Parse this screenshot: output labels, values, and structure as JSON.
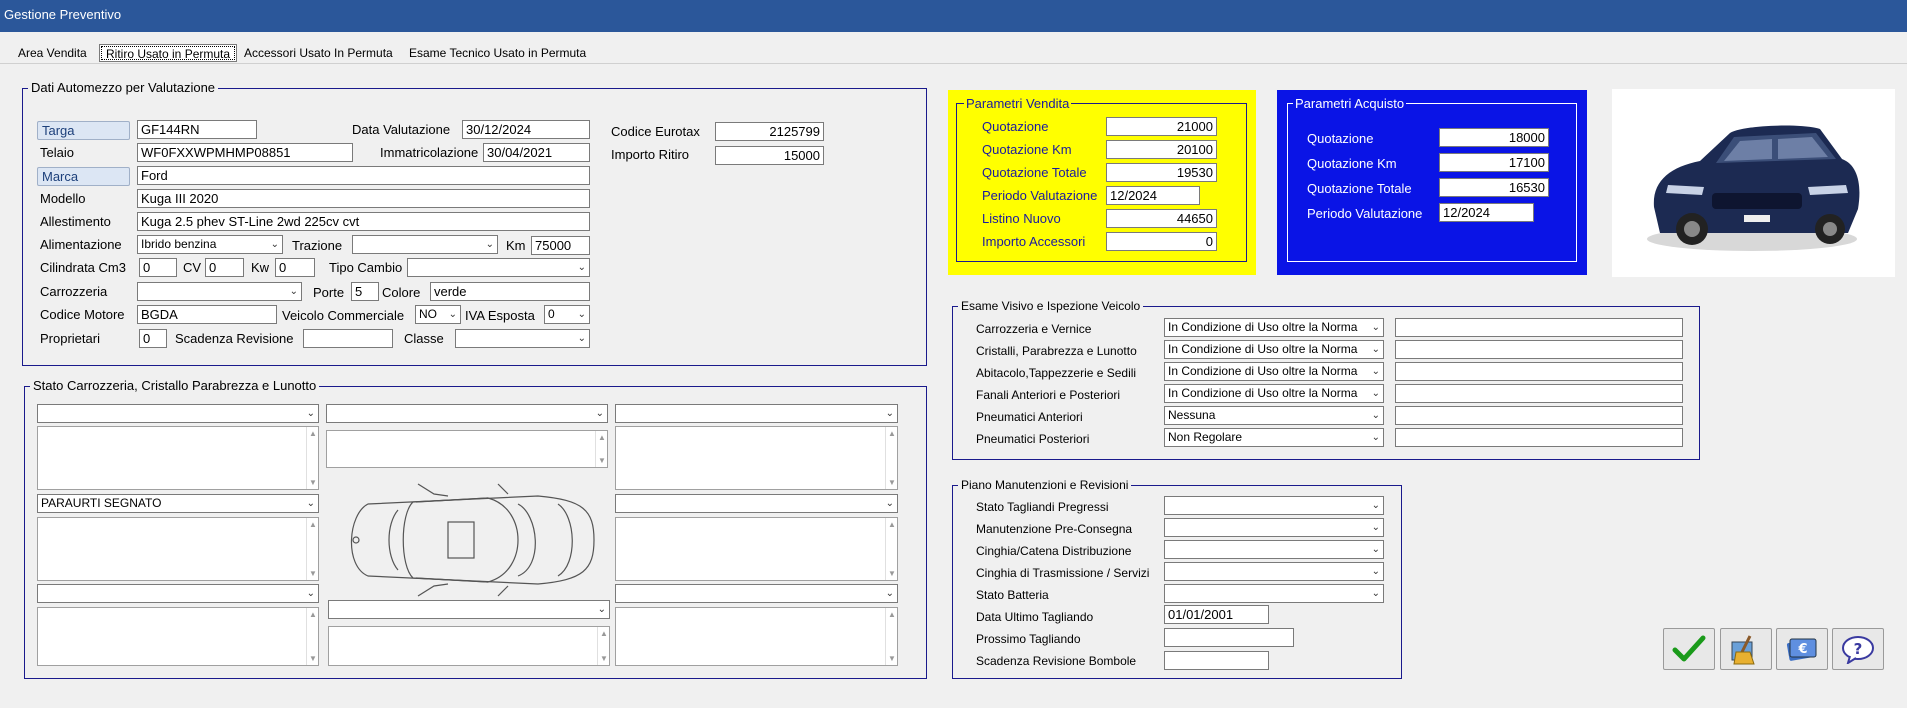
{
  "window": {
    "title": "Gestione Preventivo"
  },
  "tabs": [
    {
      "label": "Area Vendita"
    },
    {
      "label": "Ritiro Usato in Permuta"
    },
    {
      "label": "Accessori Usato In  Permuta"
    },
    {
      "label": "Esame Tecnico Usato in Permuta"
    }
  ],
  "vehicle": {
    "legend": "Dati Automezzo per Valutazione",
    "targa_label": "Targa",
    "targa": "GF144RN",
    "data_valutazione_label": "Data Valutazione",
    "data_valutazione": "30/12/2024",
    "codice_eurotax_label": "Codice Eurotax",
    "codice_eurotax": "2125799",
    "telaio_label": "Telaio",
    "telaio": "WF0FXXWPMHMP08851",
    "immatricolazione_label": "Immatricolazione",
    "immatricolazione": "30/04/2021",
    "importo_ritiro_label": "Importo Ritiro",
    "importo_ritiro": "15000",
    "marca_label": "Marca",
    "marca": "Ford",
    "modello_label": "Modello",
    "modello": "Kuga III 2020",
    "allestimento_label": "Allestimento",
    "allestimento": "Kuga 2.5 phev ST-Line 2wd 225cv cvt",
    "alimentazione_label": "Alimentazione",
    "alimentazione": "Ibrido benzina",
    "trazione_label": "Trazione",
    "trazione": "",
    "km_label": "Km",
    "km": "75000",
    "cilindrata_label": "Cilindrata Cm3",
    "cilindrata": "0",
    "cv_label": "CV",
    "cv": "0",
    "kw_label": "Kw",
    "kw": "0",
    "tipo_cambio_label": "Tipo Cambio",
    "tipo_cambio": "",
    "carrozzeria_label": "Carrozzeria",
    "carrozzeria": "",
    "porte_label": "Porte",
    "porte": "5",
    "colore_label": "Colore",
    "colore": "verde",
    "codice_motore_label": "Codice Motore",
    "codice_motore": "BGDA",
    "veicolo_commerciale_label": "Veicolo Commerciale",
    "veicolo_commerciale": "NO",
    "iva_esposta_label": "IVA Esposta",
    "iva_esposta": "0",
    "proprietari_label": "Proprietari",
    "proprietari": "0",
    "scadenza_revisione_label": "Scadenza Revisione",
    "scadenza_revisione": "",
    "classe_label": "Classe",
    "classe": ""
  },
  "body_state": {
    "legend": "Stato Carrozzeria, Cristallo Parabrezza e Lunotto",
    "middle_left_select": "PARAURTI SEGNATO"
  },
  "sales": {
    "legend": "Parametri Vendita",
    "quotazione_label": "Quotazione",
    "quotazione": "21000",
    "quotazione_km_label": "Quotazione Km",
    "quotazione_km": "20100",
    "quotazione_totale_label": "Quotazione Totale",
    "quotazione_totale": "19530",
    "periodo_label": "Periodo Valutazione",
    "periodo": "12/2024",
    "listino_label": "Listino Nuovo",
    "listino": "44650",
    "accessori_label": "Importo Accessori",
    "accessori": "0"
  },
  "purchase": {
    "legend": "Parametri  Acquisto",
    "quotazione_label": "Quotazione",
    "quotazione": "18000",
    "quotazione_km_label": "Quotazione Km",
    "quotazione_km": "17100",
    "quotazione_totale_label": "Quotazione Totale",
    "quotazione_totale": "16530",
    "periodo_label": "Periodo Valutazione",
    "periodo": "12/2024"
  },
  "inspection": {
    "legend": "Esame Visivo e Ispezione Veicolo",
    "rows": [
      {
        "label": "Carrozzeria e Vernice",
        "value": "In Condizione di Uso oltre la Norma",
        "note": ""
      },
      {
        "label": "Cristalli, Parabrezza e Lunotto",
        "value": "In Condizione di Uso oltre la Norma",
        "note": ""
      },
      {
        "label": "Abitacolo,Tappezzerie e Sedili",
        "value": "In Condizione di Uso oltre la Norma",
        "note": ""
      },
      {
        "label": "Fanali Anteriori e Posteriori",
        "value": "In Condizione di Uso oltre la Norma",
        "note": ""
      },
      {
        "label": "Pneumatici Anteriori",
        "value": "Nessuna",
        "note": ""
      },
      {
        "label": "Pneumatici Posteriori",
        "value": "Non Regolare",
        "note": ""
      }
    ]
  },
  "maintenance": {
    "legend": "Piano Manutenzioni e Revisioni",
    "rows": [
      {
        "label": "Stato Tagliandi Pregressi",
        "value": ""
      },
      {
        "label": "Manutenzione Pre-Consegna",
        "value": ""
      },
      {
        "label": "Cinghia/Catena Distribuzione",
        "value": ""
      },
      {
        "label": "Cinghia di Trasmissione / Servizi",
        "value": ""
      },
      {
        "label": "Stato Batteria",
        "value": ""
      }
    ],
    "ultimo_tagliando_label": "Data Ultimo Tagliando",
    "ultimo_tagliando": "01/01/2001",
    "prossimo_tagliando_label": "Prossimo Tagliando",
    "prossimo_tagliando": "",
    "bombole_label": "Scadenza Revisione Bombole",
    "bombole": ""
  },
  "toolbar": {
    "icons": [
      "checkmark-icon",
      "broom-icon",
      "euro-icon",
      "help-icon"
    ]
  },
  "colors": {
    "titlebar": "#2b579a",
    "sales_panel": "#ffff00",
    "purchase_panel": "#0a14e6",
    "group_border": "#1a1a8c"
  }
}
